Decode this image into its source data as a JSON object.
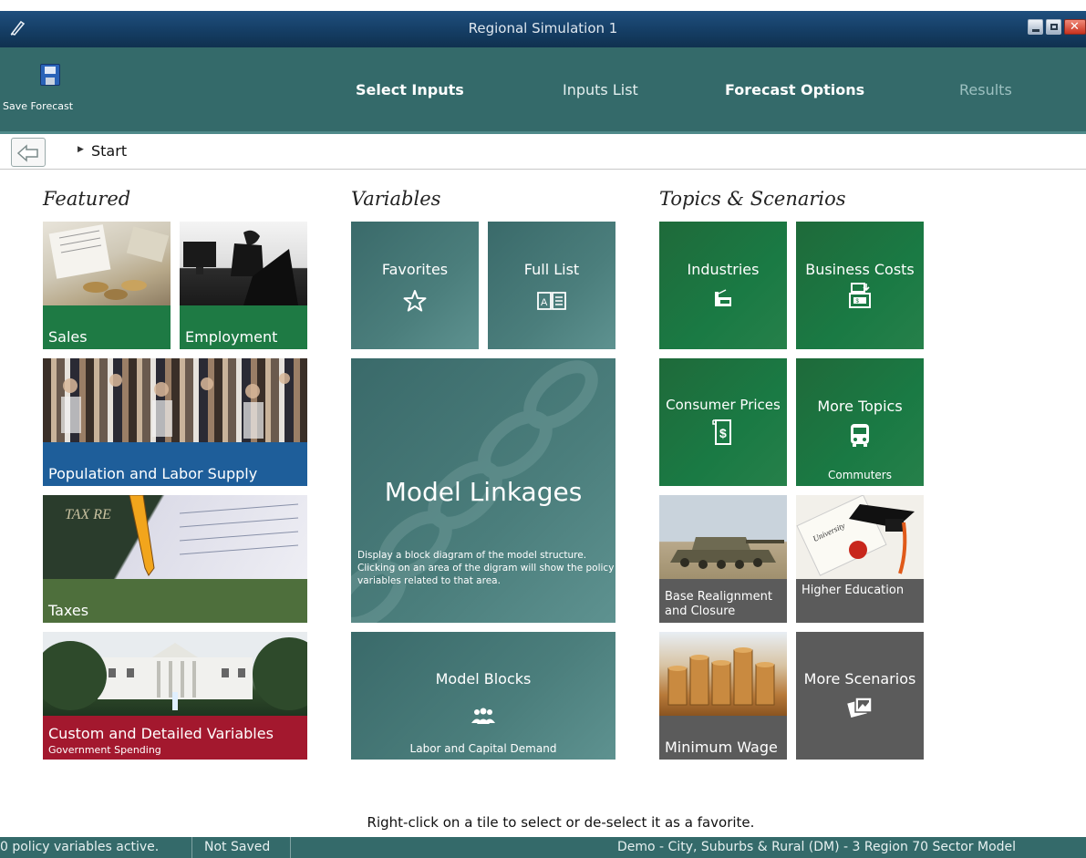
{
  "window": {
    "title": "Regional Simulation 1"
  },
  "toolbar": {
    "save_label": "Save Forecast",
    "nav": [
      "Select Inputs",
      "Inputs List",
      "Forecast Options",
      "Results"
    ]
  },
  "breadcrumb": {
    "current": "Start"
  },
  "sections": {
    "featured": "Featured",
    "variables": "Variables",
    "topics": "Topics & Scenarios"
  },
  "featured_tiles": {
    "sales": "Sales",
    "employment": "Employment",
    "population": "Population and Labor Supply",
    "taxes": "Taxes",
    "custom": "Custom and Detailed Variables",
    "custom_sub": "Government Spending"
  },
  "variable_tiles": {
    "favorites": "Favorites",
    "full_list": "Full List",
    "model_linkages": "Model Linkages",
    "model_linkages_desc": "Display a block diagram of the model structure.  Clicking on an area of the digram will show the policy variables related to that area.",
    "model_blocks": "Model Blocks",
    "model_blocks_sub": "Labor and Capital Demand"
  },
  "topic_tiles": {
    "industries": "Industries",
    "business_costs": "Business Costs",
    "consumer_prices": "Consumer Prices",
    "more_topics": "More Topics",
    "more_topics_sub": "Commuters",
    "base_realignment": "Base Realignment and Closure",
    "higher_education": "Higher Education",
    "minimum_wage": "Minimum Wage",
    "more_scenarios": "More Scenarios"
  },
  "hint": "Right-click on a tile to select or de-select it as a favorite.",
  "status": {
    "active": "0 policy variables active.",
    "saved": "Not Saved",
    "model": "Demo - City, Suburbs & Rural (DM) -  3 Region 70 Sector Model"
  },
  "colors": {
    "band": "#346a6a",
    "teal_tile": "#4b7e7c",
    "green_tile": "#1a7a44",
    "pop_blue": "#1e5e9a",
    "taxes_olive": "#4e6f3c",
    "custom_red": "#a3182e"
  }
}
